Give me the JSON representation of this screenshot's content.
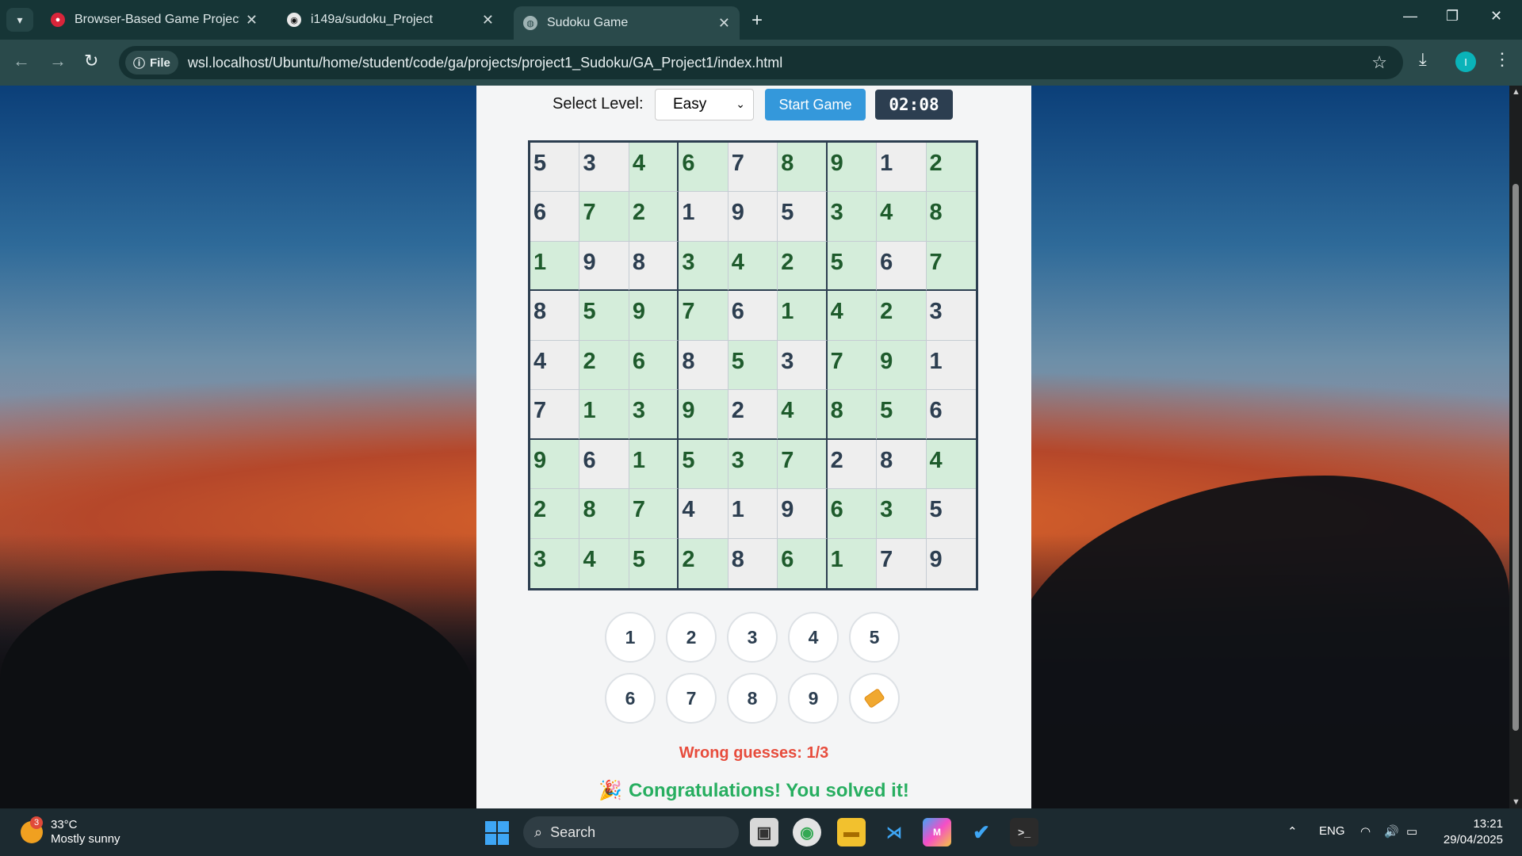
{
  "browser": {
    "tabs": [
      {
        "title": "Browser-Based Game Project D",
        "active": false
      },
      {
        "title": "i149a/sudoku_Project",
        "active": false
      },
      {
        "title": "Sudoku Game",
        "active": true
      }
    ],
    "address": {
      "chip_label": "File",
      "url": "wsl.localhost/Ubuntu/home/student/code/ga/projects/project1_Sudoku/GA_Project1/index.html"
    },
    "profile_initial": "I"
  },
  "game": {
    "level_label": "Select Level:",
    "level_value": "Easy",
    "start_label": "Start Game",
    "timer": "02:08",
    "grid": [
      [
        "5",
        "3",
        "4",
        "6",
        "7",
        "8",
        "9",
        "1",
        "2"
      ],
      [
        "6",
        "7",
        "2",
        "1",
        "9",
        "5",
        "3",
        "4",
        "8"
      ],
      [
        "1",
        "9",
        "8",
        "3",
        "4",
        "2",
        "5",
        "6",
        "7"
      ],
      [
        "8",
        "5",
        "9",
        "7",
        "6",
        "1",
        "4",
        "2",
        "3"
      ],
      [
        "4",
        "2",
        "6",
        "8",
        "5",
        "3",
        "7",
        "9",
        "1"
      ],
      [
        "7",
        "1",
        "3",
        "9",
        "2",
        "4",
        "8",
        "5",
        "6"
      ],
      [
        "9",
        "6",
        "1",
        "5",
        "3",
        "7",
        "2",
        "8",
        "4"
      ],
      [
        "2",
        "8",
        "7",
        "4",
        "1",
        "9",
        "6",
        "3",
        "5"
      ],
      [
        "3",
        "4",
        "5",
        "2",
        "8",
        "6",
        "1",
        "7",
        "9"
      ]
    ],
    "user_filled": [
      [
        0,
        0,
        1,
        1,
        0,
        1,
        1,
        0,
        1
      ],
      [
        0,
        1,
        1,
        0,
        0,
        0,
        1,
        1,
        1
      ],
      [
        1,
        0,
        0,
        1,
        1,
        1,
        1,
        0,
        1
      ],
      [
        0,
        1,
        1,
        1,
        0,
        1,
        1,
        1,
        0
      ],
      [
        0,
        1,
        1,
        0,
        1,
        0,
        1,
        1,
        0
      ],
      [
        0,
        1,
        1,
        1,
        0,
        1,
        1,
        1,
        0
      ],
      [
        1,
        0,
        1,
        1,
        1,
        1,
        0,
        0,
        1
      ],
      [
        1,
        1,
        1,
        0,
        0,
        0,
        1,
        1,
        0
      ],
      [
        1,
        1,
        1,
        1,
        0,
        1,
        1,
        0,
        0
      ]
    ],
    "numpad": [
      "1",
      "2",
      "3",
      "4",
      "5",
      "6",
      "7",
      "8",
      "9"
    ],
    "wrong_guesses": "Wrong guesses: 1/3",
    "congrats": "Congratulations! You solved it!"
  },
  "taskbar": {
    "weather_temp": "33°C",
    "weather_cond": "Mostly sunny",
    "weather_badge": "3",
    "search_placeholder": "Search",
    "language": "ENG",
    "time": "13:21",
    "date": "29/04/2025"
  },
  "colors": {
    "accent": "#3498db",
    "timer_bg": "#2c3e50",
    "user_cell": "#d4edda",
    "given_cell": "#eeeeee",
    "wrong": "#e74c3c",
    "success": "#27ae60"
  }
}
